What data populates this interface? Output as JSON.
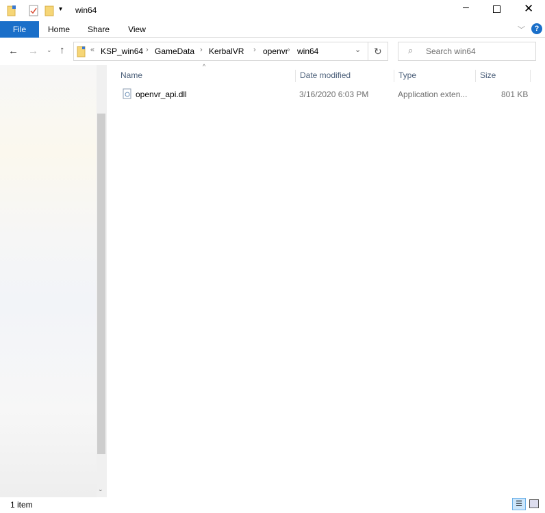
{
  "window": {
    "title": "win64"
  },
  "ribbon": {
    "tabs": [
      "File",
      "Home",
      "Share",
      "View"
    ]
  },
  "nav": {
    "path": [
      "KSP_win64",
      "GameData",
      "KerbalVR",
      "openvr",
      "win64"
    ],
    "overflow": "«"
  },
  "search": {
    "placeholder": "Search win64"
  },
  "columns": [
    "Name",
    "Date modified",
    "Type",
    "Size"
  ],
  "files": [
    {
      "name": "openvr_api.dll",
      "date": "3/16/2020 6:03 PM",
      "type": "Application exten...",
      "size": "801 KB"
    }
  ],
  "status": {
    "count": "1 item"
  },
  "colors": {
    "accent": "#1a6fc9"
  }
}
